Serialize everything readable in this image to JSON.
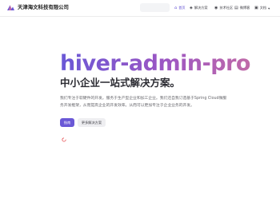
{
  "nav": {
    "brand": "天津海文科技有限公司",
    "items": [
      {
        "icon": "home-icon",
        "glyph": "⌂",
        "label": "首页",
        "active": true
      },
      {
        "icon": "solution-icon",
        "glyph": "◈",
        "label": "解决方案",
        "active": false
      },
      {
        "icon": "community-icon",
        "glyph": "◉",
        "label": "技术社区",
        "active": false
      },
      {
        "icon": "blog-icon",
        "glyph": "▤",
        "label": "微博客",
        "active": false
      },
      {
        "icon": "docs-icon",
        "glyph": "▣",
        "label": "文档",
        "active": false
      }
    ],
    "docs_chevron": "▾"
  },
  "hero": {
    "title": "hiver-admin-pro",
    "subtitle": "中小企业一站式解决方案。",
    "description": "我们专注于软硬件的开发。服务于生产型企业和加工企业。我们还自我订造基于Spring Cloud微服务开发框架，从而提高企业的开发效率。从而可以更加专注于企业业务的开发。",
    "primary_button": "指南",
    "secondary_button": "更多解决方案"
  },
  "colors": {
    "accent": "#6a58d6",
    "spinner": "#e5474b"
  }
}
